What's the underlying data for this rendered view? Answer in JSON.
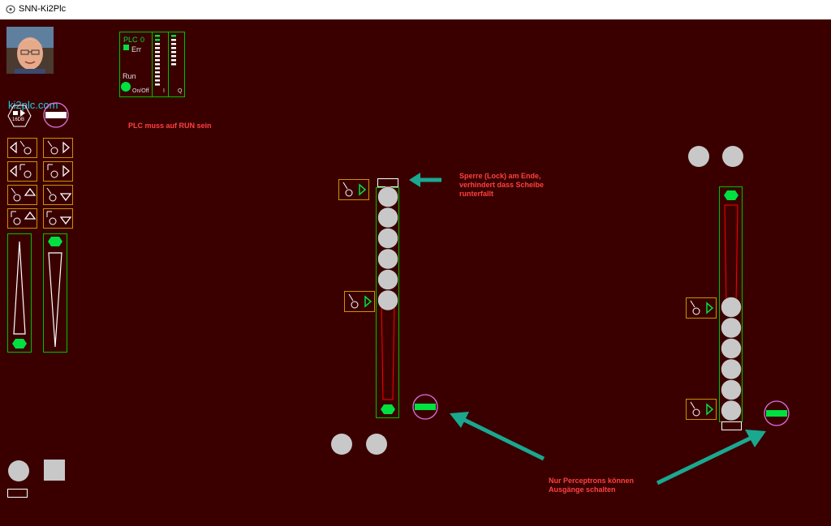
{
  "window": {
    "title": "SNN-Ki2Plc"
  },
  "brand": {
    "link": "ki2plc.com"
  },
  "plc": {
    "label": "PLC",
    "number": "0",
    "err_label": "Err",
    "run_label": "Run",
    "onoff_label": "On/Off",
    "input_label": "I",
    "output_label": "Q",
    "input_leds": 13,
    "output_leds": 8
  },
  "toolbox": {
    "hex_label": "16DB"
  },
  "notes": {
    "plc_run": "PLC muss auf RUN sein",
    "lock_line1": "Sperre (Lock) am Ende,",
    "lock_line2": "verhindert dass Scheibe",
    "lock_line3": "runterfallt",
    "perceptron_line1": "Nur Perceptrons können",
    "perceptron_line2": "Ausgänge schalten"
  },
  "colors": {
    "background": "#3a0000",
    "frame_green": "#00c000",
    "led_green": "#00e040",
    "sensor_frame": "#d09000",
    "note_red": "#ff4040",
    "arrow_teal": "#1aa890",
    "disc_gray": "#c8c8c8",
    "link_cyan": "#29c8e6"
  },
  "stacks": {
    "left_stack_discs": 6,
    "right_stack_discs": 6
  }
}
